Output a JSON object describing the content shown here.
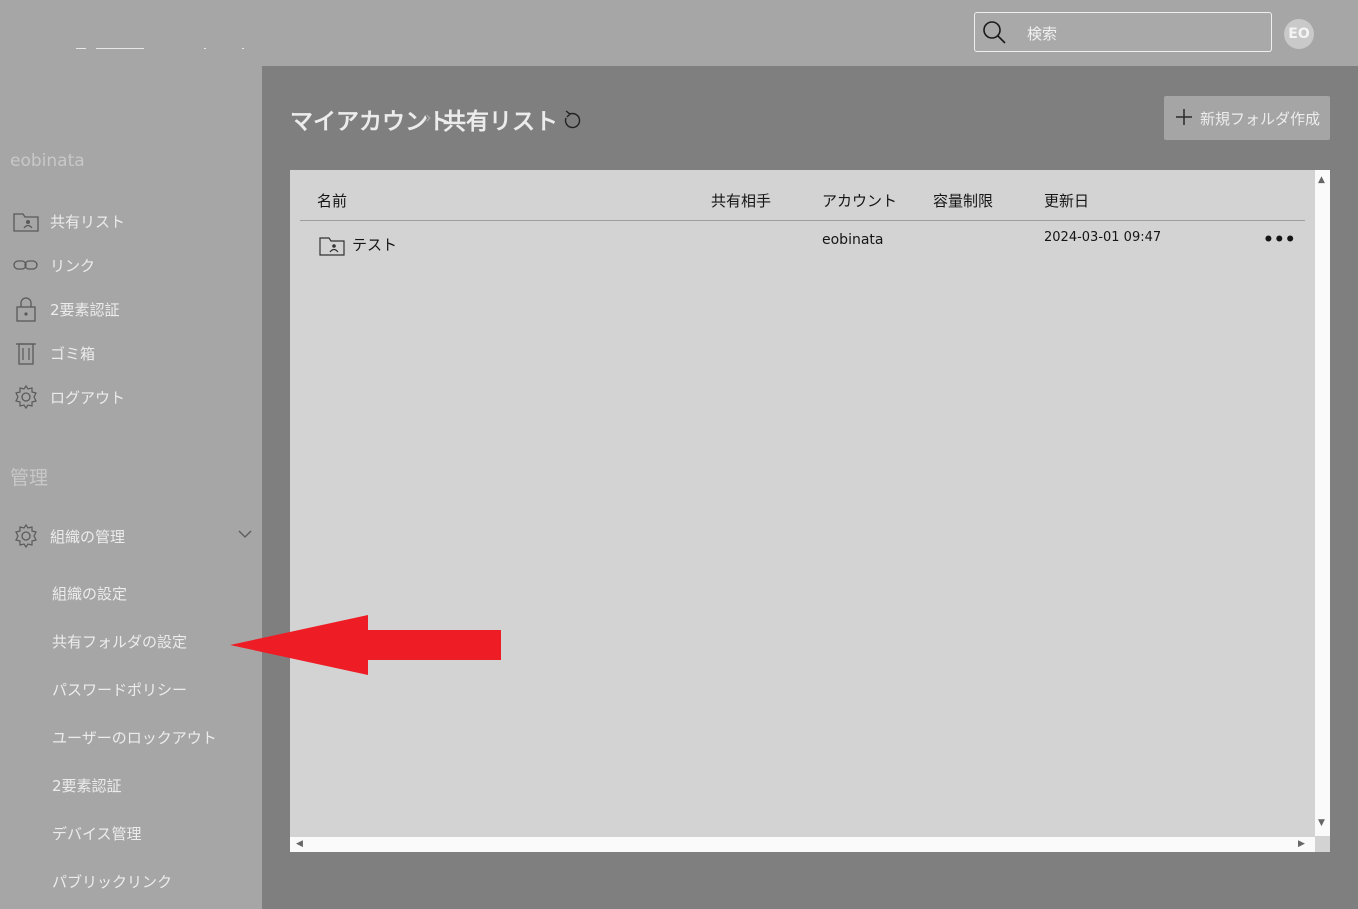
{
  "header": {
    "search_placeholder": "検索",
    "avatar_initials": "EO"
  },
  "sidebar": {
    "user_name": "eobinata",
    "items": [
      {
        "label": "共有リスト",
        "icon": "folder-user-icon"
      },
      {
        "label": "リンク",
        "icon": "link-icon"
      },
      {
        "label": "2要素認証",
        "icon": "lock-icon"
      },
      {
        "label": "ゴミ箱",
        "icon": "trash-icon"
      },
      {
        "label": "ログアウト",
        "icon": "gear-icon"
      }
    ],
    "section_title": "管理",
    "org_group": {
      "label": "組織の管理",
      "icon": "gear-icon",
      "expanded": true
    },
    "org_items": [
      {
        "label": "組織の設定"
      },
      {
        "label": "共有フォルダの設定"
      },
      {
        "label": "パスワードポリシー"
      },
      {
        "label": "ユーザーのロックアウト"
      },
      {
        "label": "2要素認証"
      },
      {
        "label": "デバイス管理"
      },
      {
        "label": "パブリックリンク"
      }
    ]
  },
  "main": {
    "breadcrumb": [
      "マイアカウント",
      "共有リスト"
    ],
    "new_folder_label": "新規フォルダ作成",
    "table": {
      "columns": [
        "名前",
        "共有相手",
        "アカウント",
        "容量制限",
        "更新日"
      ],
      "rows": [
        {
          "name": "テスト",
          "shared_with": "",
          "account": "eobinata",
          "quota": "",
          "updated": "2024-03-01 09:47"
        }
      ]
    }
  },
  "annotation": {
    "color": "#ee1c25",
    "points_to": "共有フォルダの設定"
  }
}
